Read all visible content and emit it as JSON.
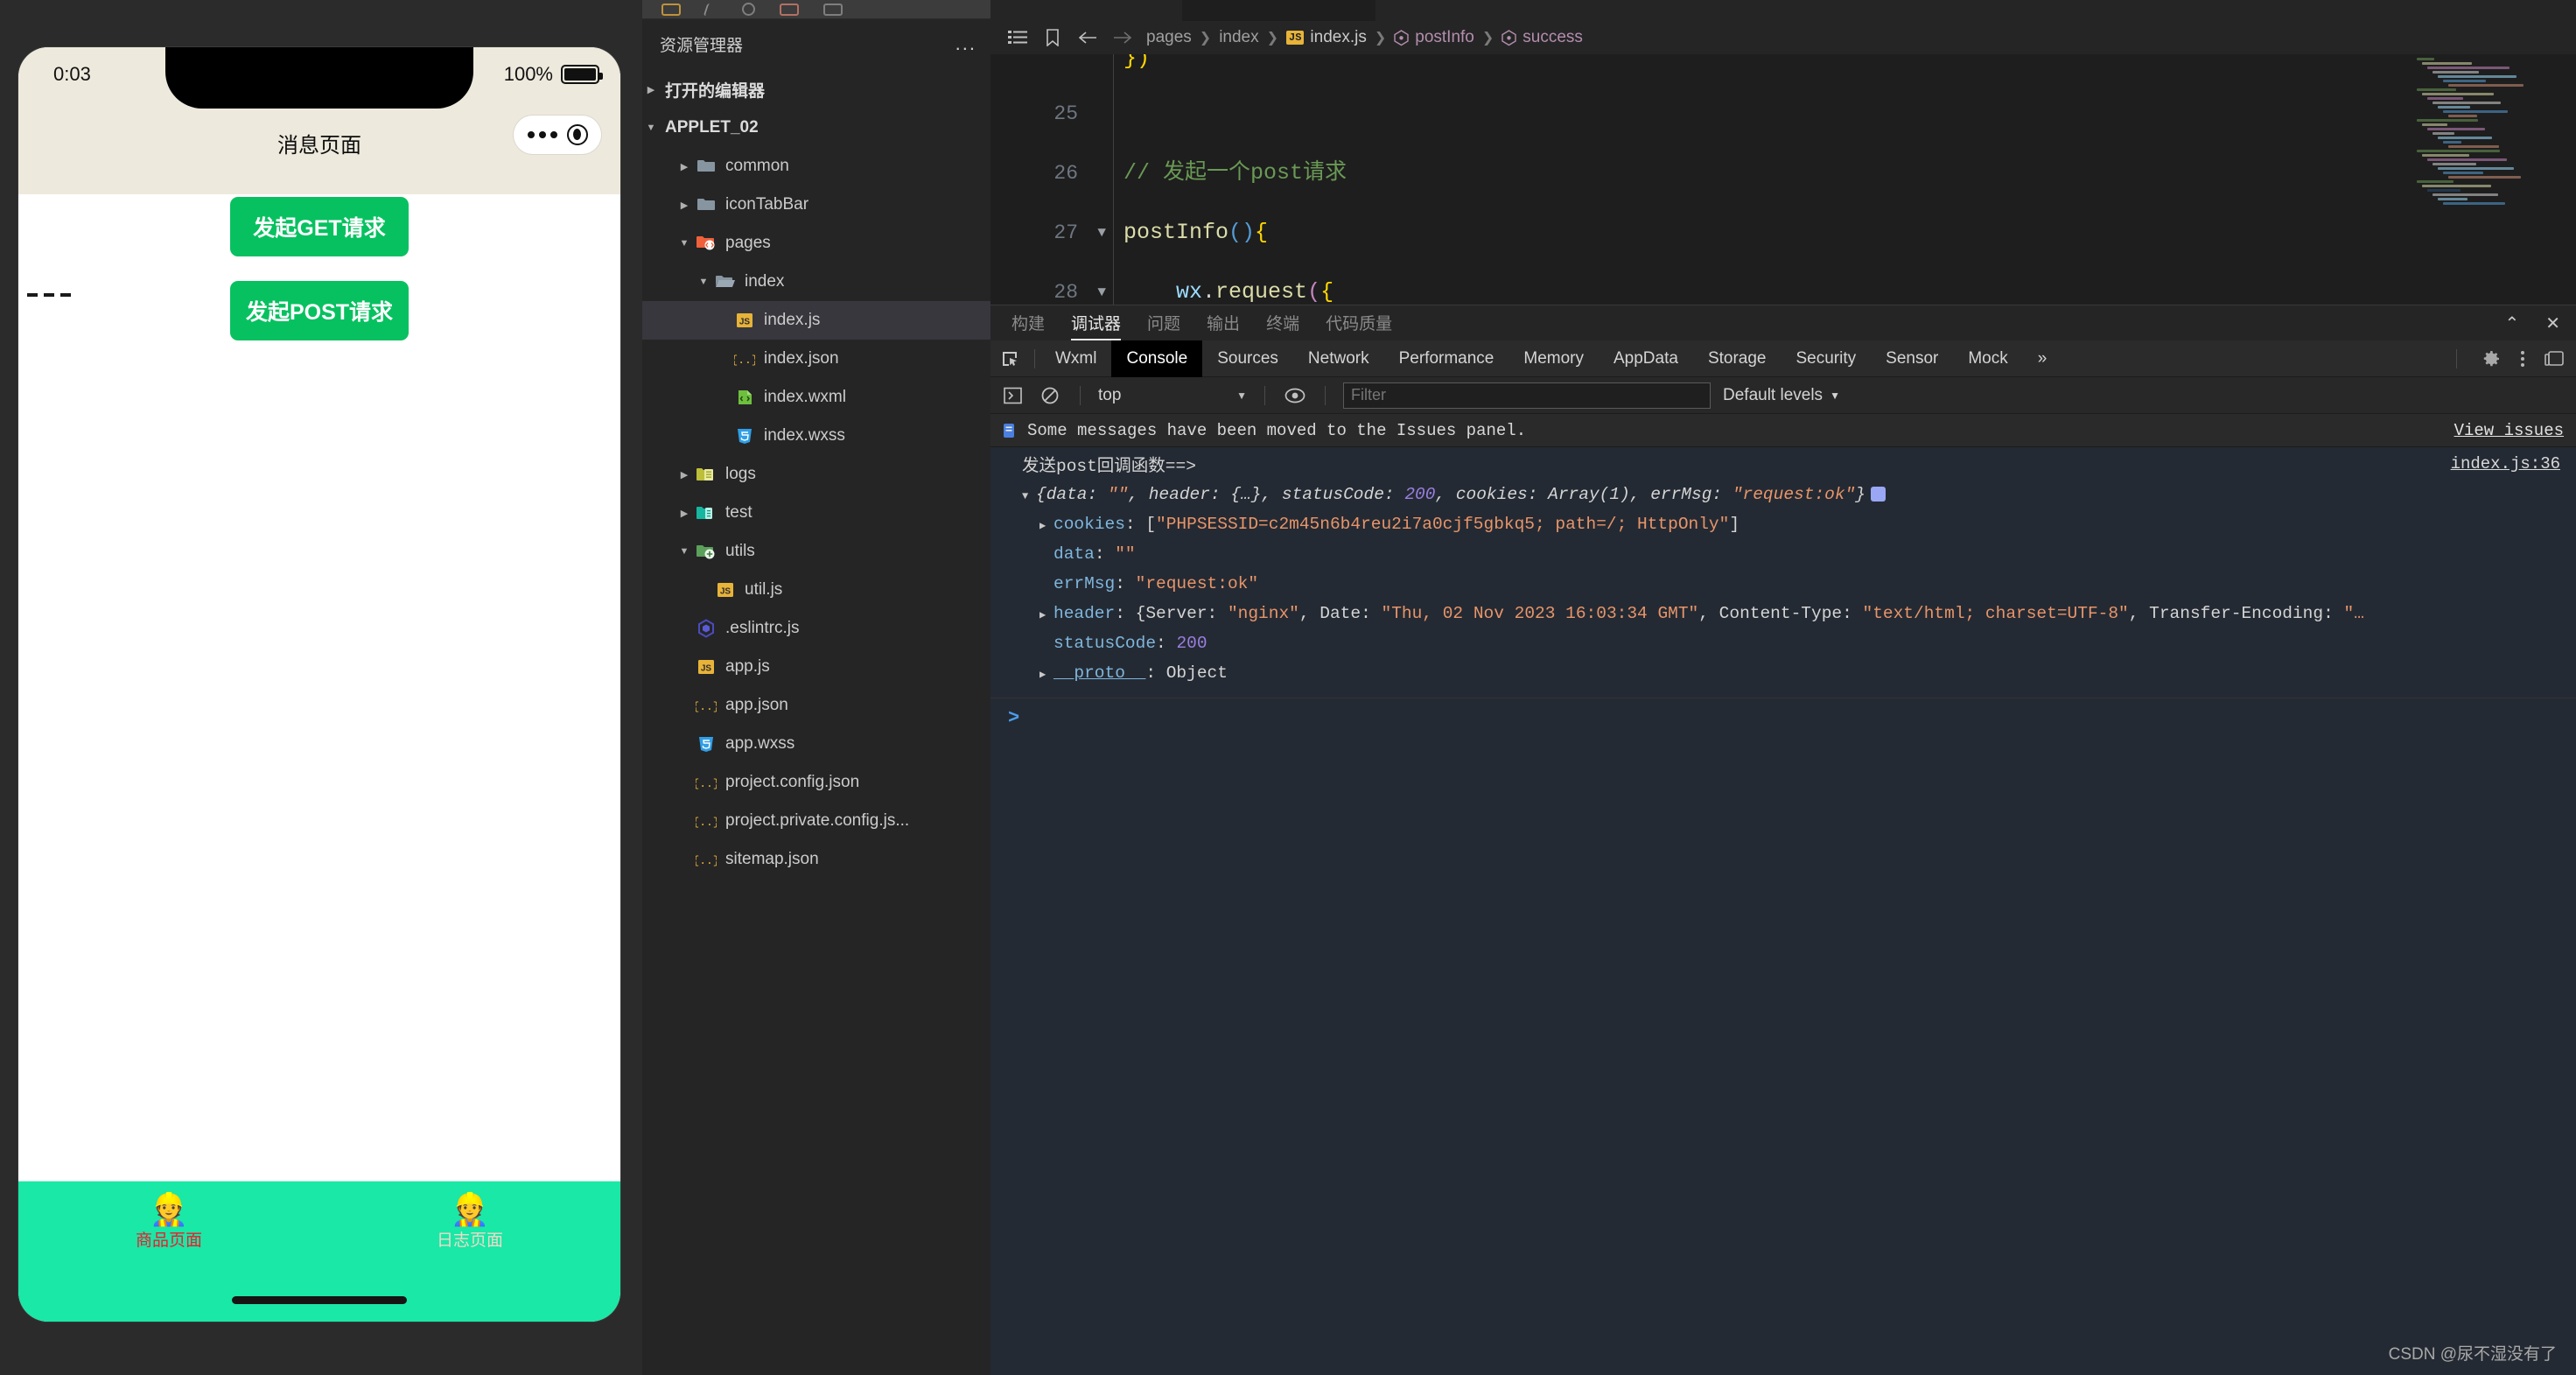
{
  "simulator": {
    "status": {
      "time": "0:03",
      "battery_pct": "100%"
    },
    "nav_title": "消息页面",
    "capsule": {
      "more": "more-dots",
      "target": "target-icon"
    },
    "buttons": [
      {
        "label": "发起GET请求"
      },
      {
        "label": "发起POST请求"
      }
    ],
    "tabbar": [
      {
        "icon": "👷",
        "label": "商品页面",
        "active": true
      },
      {
        "icon": "👷",
        "label": "日志页面",
        "active": false
      }
    ]
  },
  "explorer": {
    "title": "资源管理器",
    "more": "...",
    "sections": [
      {
        "label": "打开的编辑器",
        "expanded": false
      },
      {
        "label": "APPLET_02",
        "expanded": true
      }
    ],
    "tree": [
      {
        "label": "common",
        "type": "folder",
        "depth": 1,
        "arrow": "collapsed"
      },
      {
        "label": "iconTabBar",
        "type": "folder",
        "depth": 1,
        "arrow": "collapsed"
      },
      {
        "label": "pages",
        "type": "folder-pages",
        "depth": 1,
        "arrow": "expanded"
      },
      {
        "label": "index",
        "type": "folder-open",
        "depth": 2,
        "arrow": "expanded"
      },
      {
        "label": "index.js",
        "type": "js",
        "depth": 3,
        "arrow": "none",
        "selected": true
      },
      {
        "label": "index.json",
        "type": "json",
        "depth": 3,
        "arrow": "none"
      },
      {
        "label": "index.wxml",
        "type": "wxml",
        "depth": 3,
        "arrow": "none"
      },
      {
        "label": "index.wxss",
        "type": "wxss",
        "depth": 3,
        "arrow": "none"
      },
      {
        "label": "logs",
        "type": "folder-logs",
        "depth": 1,
        "arrow": "collapsed"
      },
      {
        "label": "test",
        "type": "folder-test",
        "depth": 1,
        "arrow": "collapsed"
      },
      {
        "label": "utils",
        "type": "folder-utils",
        "depth": 1,
        "arrow": "expanded"
      },
      {
        "label": "util.js",
        "type": "js",
        "depth": 2,
        "arrow": "none"
      },
      {
        "label": ".eslintrc.js",
        "type": "eslint",
        "depth": 1,
        "arrow": "none"
      },
      {
        "label": "app.js",
        "type": "js",
        "depth": 1,
        "arrow": "none"
      },
      {
        "label": "app.json",
        "type": "json",
        "depth": 1,
        "arrow": "none"
      },
      {
        "label": "app.wxss",
        "type": "wxss",
        "depth": 1,
        "arrow": "none"
      },
      {
        "label": "project.config.json",
        "type": "json",
        "depth": 1,
        "arrow": "none"
      },
      {
        "label": "project.private.config.js...",
        "type": "json",
        "depth": 1,
        "arrow": "none"
      },
      {
        "label": "sitemap.json",
        "type": "json",
        "depth": 1,
        "arrow": "none"
      }
    ]
  },
  "breadcrumb": {
    "icons": [
      "outline-icon",
      "bookmark-icon",
      "back-arrow-icon",
      "forward-arrow-icon"
    ],
    "items": [
      {
        "label": "pages",
        "kind": "folder"
      },
      {
        "label": "index",
        "kind": "folder"
      },
      {
        "label": "index.js",
        "kind": "file"
      },
      {
        "label": "postInfo",
        "kind": "symbol"
      },
      {
        "label": "success",
        "kind": "symbol"
      }
    ]
  },
  "editor": {
    "lines": [
      {
        "num": "25",
        "fold": "",
        "text": ""
      },
      {
        "num": "26",
        "fold": "",
        "text": "// 发起一个post请求"
      },
      {
        "num": "27",
        "fold": "v",
        "text": "postInfo(){"
      },
      {
        "num": "28",
        "fold": "v",
        "text": "wx.request({"
      }
    ],
    "partial_top": "})"
  },
  "panel": {
    "tabs": [
      {
        "label": "构建",
        "active": false
      },
      {
        "label": "调试器",
        "active": true
      },
      {
        "label": "问题",
        "active": false
      },
      {
        "label": "输出",
        "active": false
      },
      {
        "label": "终端",
        "active": false
      },
      {
        "label": "代码质量",
        "active": false
      }
    ],
    "actions": [
      {
        "name": "collapse-panel",
        "glyph": "⌃"
      },
      {
        "name": "close-panel",
        "glyph": "✕"
      }
    ]
  },
  "devtools": {
    "inspect_icon": "inspect-element-icon",
    "tabs": [
      {
        "label": "Wxml",
        "active": false
      },
      {
        "label": "Console",
        "active": true
      },
      {
        "label": "Sources",
        "active": false
      },
      {
        "label": "Network",
        "active": false
      },
      {
        "label": "Performance",
        "active": false
      },
      {
        "label": "Memory",
        "active": false
      },
      {
        "label": "AppData",
        "active": false
      },
      {
        "label": "Storage",
        "active": false
      },
      {
        "label": "Security",
        "active": false
      },
      {
        "label": "Sensor",
        "active": false
      },
      {
        "label": "Mock",
        "active": false
      }
    ],
    "overflow": "»",
    "right_icons": [
      "settings-gear-icon",
      "more-vertical-icon",
      "dock-panel-icon"
    ]
  },
  "console": {
    "toolbar": {
      "sidebar_toggle": "console-sidebar-icon",
      "clear": "clear-console-icon",
      "context": "top",
      "eye": "live-expression-icon",
      "filter_placeholder": "Filter",
      "filter_value": "",
      "levels": "Default levels"
    },
    "issues": {
      "icon": "issues-icon",
      "text": "Some messages have been moved to the Issues panel.",
      "link": "View issues"
    },
    "log": {
      "source": "index.js:36",
      "message": "发送post回调函数==>",
      "summary_prefix": "{",
      "summary": [
        {
          "key": "data",
          "sep": ": ",
          "val": "\"\"",
          "type": "str"
        },
        {
          "key": "header",
          "sep": ": ",
          "val": "{…}",
          "type": "plain"
        },
        {
          "key": "statusCode",
          "sep": ": ",
          "val": "200",
          "type": "num"
        },
        {
          "key": "cookies",
          "sep": ": ",
          "val": "Array(1)",
          "type": "plain"
        },
        {
          "key": "errMsg",
          "sep": ": ",
          "val": "\"request:ok\"",
          "type": "str"
        }
      ],
      "summary_suffix": "}",
      "props": [
        {
          "expandable": true,
          "key": "cookies",
          "value": "[\"PHPSESSID=c2m45n6b4reu2i7a0cjf5gbkq5; path=/; HttpOnly\"]",
          "vtype": "arr"
        },
        {
          "expandable": false,
          "key": "data",
          "value": "\"\"",
          "vtype": "str"
        },
        {
          "expandable": false,
          "key": "errMsg",
          "value": "\"request:ok\"",
          "vtype": "str"
        },
        {
          "expandable": true,
          "key": "header",
          "value": "{Server: \"nginx\", Date: \"Thu, 02 Nov 2023 16:03:34 GMT\", Content-Type: \"text/html; charset=UTF-8\", Transfer-Encoding: \"…",
          "vtype": "obj"
        },
        {
          "expandable": false,
          "key": "statusCode",
          "value": "200",
          "vtype": "num"
        },
        {
          "expandable": true,
          "key": "__proto__",
          "value": "Object",
          "vtype": "proto"
        }
      ]
    },
    "prompt": ">"
  },
  "watermark": "CSDN @尿不湿没有了",
  "colors": {
    "accent_green": "#07c160",
    "tabbar_bg": "#19e8a6",
    "active_tab_red": "#ee1b2e",
    "editor_bg": "#1e1e1e",
    "console_bg": "#242A33"
  }
}
